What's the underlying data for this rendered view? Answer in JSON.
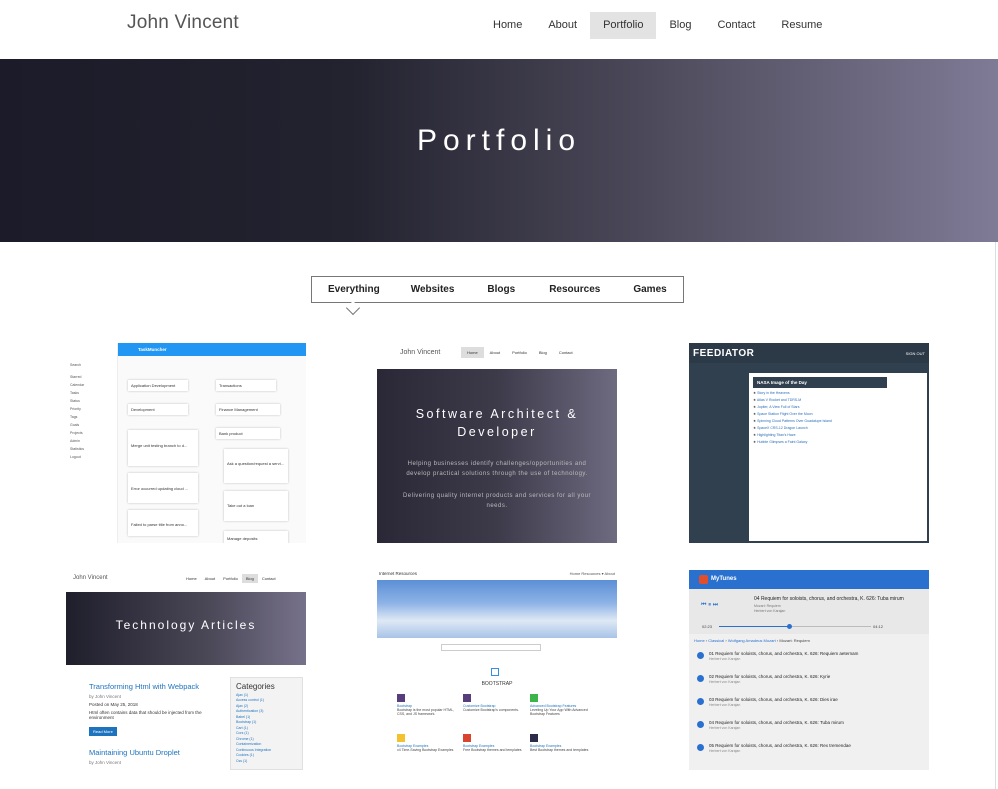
{
  "header": {
    "brand": "John Vincent",
    "nav": [
      {
        "label": "Home",
        "active": false
      },
      {
        "label": "About",
        "active": false
      },
      {
        "label": "Portfolio",
        "active": true
      },
      {
        "label": "Blog",
        "active": false
      },
      {
        "label": "Contact",
        "active": false
      },
      {
        "label": "Resume",
        "active": false
      }
    ]
  },
  "hero": {
    "title": "Portfolio"
  },
  "filters": [
    "Everything",
    "Websites",
    "Blogs",
    "Resources",
    "Games"
  ],
  "cards": {
    "taskmuncher": {
      "app": "TaskMuncher",
      "sidebar": [
        "Search",
        "Starred",
        "Calendar",
        "Tasks",
        "Status",
        "Priority",
        "Tags",
        "Goals",
        "Projects",
        "Admin",
        "Statistics",
        "Logout"
      ],
      "tasks": [
        "Application Development",
        "Transactions",
        "Development",
        "Finance Management",
        "Merge unit testing branch to d...",
        "Bank product",
        "Error occurred updating cloud ...",
        "Ask a question/request a servi...",
        "Failed to parse title from anno...",
        "Take out a loan",
        "Manage deposits"
      ]
    },
    "site": {
      "brand": "John Vincent",
      "nav": [
        "Home",
        "About",
        "Portfolio",
        "Blog",
        "Contact"
      ],
      "title_line1": "Software Architect &",
      "title_line2": "Developer",
      "text1": "Helping businesses identify challenges/opportunities and develop practical solutions through the use of technology.",
      "text2": "Delivering quality internet products and services for all your needs."
    },
    "feediator": {
      "logo": "FEEDIATOR",
      "signout": "SIGN OUT",
      "panel_title": "NASA Image of the Day",
      "rows": [
        "Story in the Heavens",
        "Atlas V Rocket and TDRS-M",
        "Jupiter, A View Full of Stars",
        "Space Station Flight Over the Moon",
        "Spinning Cloud Patterns Over Guadalupe Island",
        "SpaceX CRS-12 Dragon Launch",
        "Highlighting Titan's Haze",
        "Hubble Glimpses a Faint Galaxy"
      ]
    },
    "blog": {
      "brand": "John Vincent",
      "nav": [
        "Home",
        "About",
        "Portfolio",
        "Blog",
        "Contact"
      ],
      "band": "Technology Articles",
      "post_title": "Transforming Html with Webpack",
      "post_by": "by John Vincent",
      "post_date": "Posted on May 25, 2018",
      "post_excerpt": "Html often contains data that should be injected from the environment",
      "read_more": "Read More",
      "post2_title": "Maintaining Ubuntu Droplet",
      "post2_by": "by John Vincent",
      "categories_title": "Categories",
      "categories": [
        "Ajax (1)",
        "Access control (1)",
        "Ajax (2)",
        "Authentication (3)",
        "Babel (1)",
        "Bootstrap (1)",
        "Cart (1)",
        "Cors (1)",
        "Chrome (1)",
        "Containerization",
        "Continuous Integration",
        "Cookies (1)",
        "Css (1)"
      ]
    },
    "resources": {
      "brand": "Internet Resources",
      "nav": "Home   Resources ▾   About",
      "section": "BOOTSTRAP",
      "items": [
        {
          "title": "Bootstrap",
          "text": "Bootstrap is the most popular HTML, CSS, and JS framework."
        },
        {
          "title": "Customize Bootstrap",
          "text": "Customize Bootstrap's components."
        },
        {
          "title": "Advanced Bootstrap Features",
          "text": "Leveling Up Your App With Advanced Bootstrap Features"
        },
        {
          "title": "Bootstrap Examples",
          "text": "v4 Time-Saving Bootstrap Examples"
        },
        {
          "title": "Bootstrap Examples",
          "text": "Free Bootstrap themes and templates"
        },
        {
          "title": "Bootstrap Examples",
          "text": "Best Bootstrap themes and templates"
        }
      ]
    },
    "mytunes": {
      "app": "MyTunes",
      "now_title": "04 Requiem for soloists, chorus, and orchestra, K. 626: Tuba mirum",
      "now_artist": "Mozart: Requiem",
      "now_conductor": "Herbert von Karajan",
      "time_elapsed": "02:23",
      "time_total": "04:12",
      "progress": 0.46,
      "breadcrumb": [
        "Home",
        "Classical",
        "Wolfgang Amadeus Mozart",
        "Mozart: Requiem"
      ],
      "tracks": [
        {
          "title": "01 Requiem for soloists, chorus, and orchestra, K. 626: Requiem aeternam",
          "artist": "Herbert von Karajan"
        },
        {
          "title": "02 Requiem for soloists, chorus, and orchestra, K. 626: Kyrie",
          "artist": "Herbert von Karajan"
        },
        {
          "title": "03 Requiem for soloists, chorus, and orchestra, K. 626: Dies irae",
          "artist": "Herbert von Karajan"
        },
        {
          "title": "04 Requiem for soloists, chorus, and orchestra, K. 626: Tuba mirum",
          "artist": "Herbert von Karajan"
        },
        {
          "title": "05 Requiem for soloists, chorus, and orchestra, K. 626: Rex tremendae",
          "artist": "Herbert von Karajan"
        }
      ]
    }
  }
}
